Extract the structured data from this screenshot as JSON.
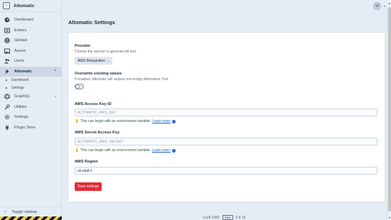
{
  "brand": {
    "logo_letter": "C",
    "name": "Altomatic"
  },
  "nav": [
    {
      "label": "Dashboard",
      "icon": "dashboard-icon"
    },
    {
      "label": "Entries",
      "icon": "entries-icon"
    },
    {
      "label": "Globals",
      "icon": "globe-icon"
    },
    {
      "label": "Assets",
      "icon": "image-icon"
    },
    {
      "label": "Users",
      "icon": "users-icon"
    },
    {
      "label": "Altomatic",
      "icon": "plugin-icon",
      "active": true
    },
    {
      "label": "GraphQL",
      "icon": "graphql-icon"
    },
    {
      "label": "Utilities",
      "icon": "wrench-icon"
    },
    {
      "label": "Settings",
      "icon": "gear-icon"
    },
    {
      "label": "Plugin Store",
      "icon": "plug-icon"
    }
  ],
  "subnav": [
    "Dashboard",
    "Settings"
  ],
  "sidebar_toggle": "Toggle sidebar",
  "user": {
    "initial": "W"
  },
  "page": {
    "title": "Altomatic Settings"
  },
  "provider": {
    "label": "Provider",
    "desc": "Choose the service to generate Alt text.",
    "selected": "AWS Rekognition"
  },
  "overwrite": {
    "label": "Overwrite existing values",
    "desc": "If enabled, Altomatic will replace non-empty Alternative Text."
  },
  "access_key": {
    "label": "AWS Access Key ID",
    "placeholder": "ALTOMATIC_AWS_KEY"
  },
  "secret_key": {
    "label": "AWS Secret Access Key",
    "placeholder": "ALTOMATIC_AWS_SECRET"
  },
  "env_tip": {
    "text": "This can begin with an environment variable.",
    "link": "Learn more"
  },
  "region": {
    "label": "AWS Region",
    "value": "us-east-1"
  },
  "save_label": "Save settings",
  "footer": {
    "product": "Craft CMS",
    "edition": "PRO",
    "version": "5.8.18"
  },
  "colors": {
    "accent": "#e12d39",
    "sidebar_bg": "#e4edf6",
    "link": "#1c5cc0"
  }
}
